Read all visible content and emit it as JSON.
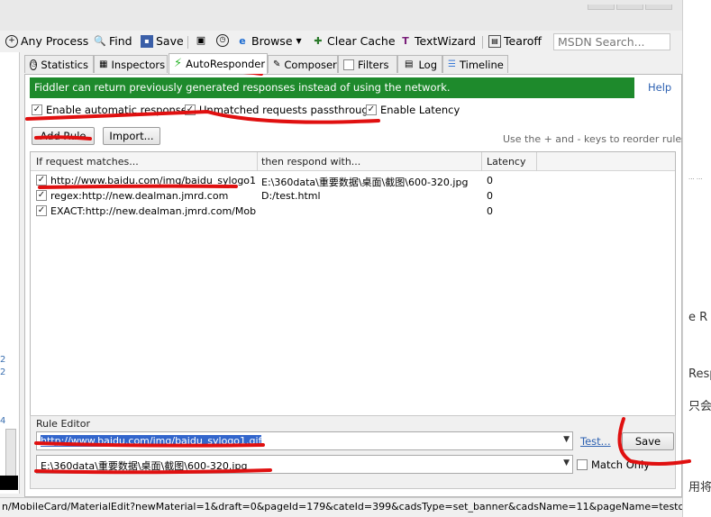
{
  "toolbar": {
    "items": [
      "Any Process",
      "Find",
      "Save",
      "Browse",
      "Clear Cache",
      "TextWizard",
      "Tearoff"
    ],
    "search_placeholder": "MSDN Search..."
  },
  "tabs": [
    "Statistics",
    "Inspectors",
    "AutoResponder",
    "Composer",
    "Filters",
    "Log",
    "Timeline"
  ],
  "banner": {
    "text": "Fiddler can return previously generated responses instead of using the network.",
    "help": "Help"
  },
  "options": {
    "enable_auto": "Enable automatic responses",
    "unmatched": "Unmatched requests passthrough",
    "latency": "Enable Latency"
  },
  "buttons": {
    "add_rule": "Add Rule",
    "import": "Import...",
    "test": "Test...",
    "save": "Save"
  },
  "hint": "Use the + and - keys to reorder rules.",
  "table": {
    "headers": [
      "If request matches...",
      "then respond with...",
      "Latency"
    ],
    "rows": [
      {
        "match": "http://www.baidu.com/img/baidu_sylogo1.gif",
        "respond": "E:\\360data\\重要数据\\桌面\\截图\\600-320.jpg",
        "latency": "0"
      },
      {
        "match": "regex:http://new.dealman.jmrd.com",
        "respond": "D:/test.html",
        "latency": "0"
      },
      {
        "match": "EXACT:http://new.dealman.jmrd.com/Mobile...",
        "respond": "",
        "latency": "0"
      }
    ]
  },
  "editor": {
    "label": "Rule Editor",
    "match_value": "http://www.baidu.com/img/baidu_sylogo1.gif",
    "respond_value": "E:\\360data\\重要数据\\桌面\\截图\\600-320.jpg",
    "match_only": "Match Only"
  },
  "status": "n/MobileCard/MaterialEdit?newMaterial=1&draft=0&pageId=179&cateId=399&cadsType=set_banner&cadsName=11&pageName=testcccca",
  "side": {
    "left_nums": [
      "2",
      "2",
      "4"
    ],
    "right_texts": [
      "e R",
      "Resp",
      "只会中",
      "用将"
    ]
  },
  "colors": {
    "banner": "#1e8a2c",
    "annotation": "#e01010",
    "link": "#2d61b2"
  }
}
